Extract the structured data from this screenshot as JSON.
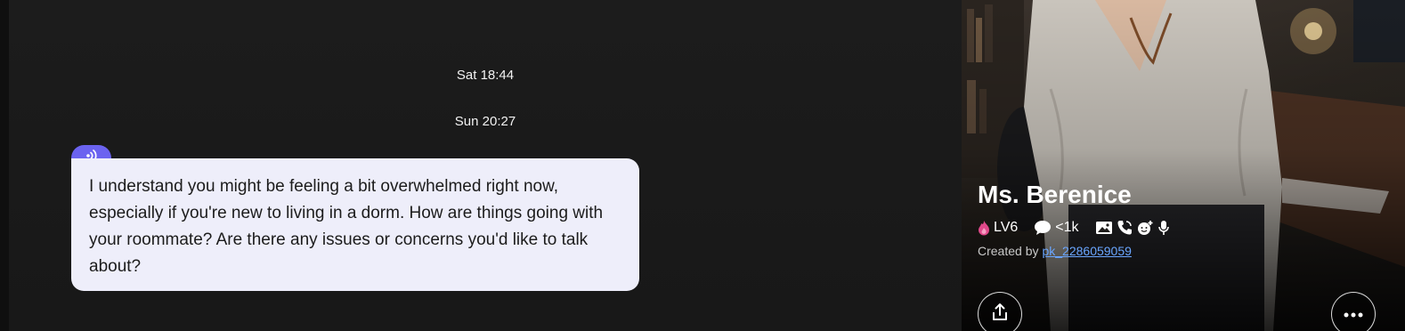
{
  "chat": {
    "timestamps": [
      "Sat 18:44",
      "Sun 20:27"
    ],
    "message": {
      "text": "I understand you might be feeling a bit overwhelmed right now, especially if you're new to living in a dorm. How are things going with your roommate? Are there any issues or concerns you'd like to talk about?",
      "audio_icon": "sound-wave-icon"
    }
  },
  "profile": {
    "name": "Ms. Berenice",
    "level": "LV6",
    "messages": "<1k",
    "created_by_label": "Created by",
    "creator": "pk_2286059059",
    "feature_icons": [
      "image-icon",
      "phone-icon",
      "selfie-icon",
      "mic-icon"
    ],
    "buttons": {
      "share_icon": "share-icon",
      "more_icon": "more-icon"
    }
  },
  "colors": {
    "accent": "#6b63f0",
    "bubble": "#eeeefa",
    "link": "#6aa6ff",
    "flame": "#e0488a"
  }
}
